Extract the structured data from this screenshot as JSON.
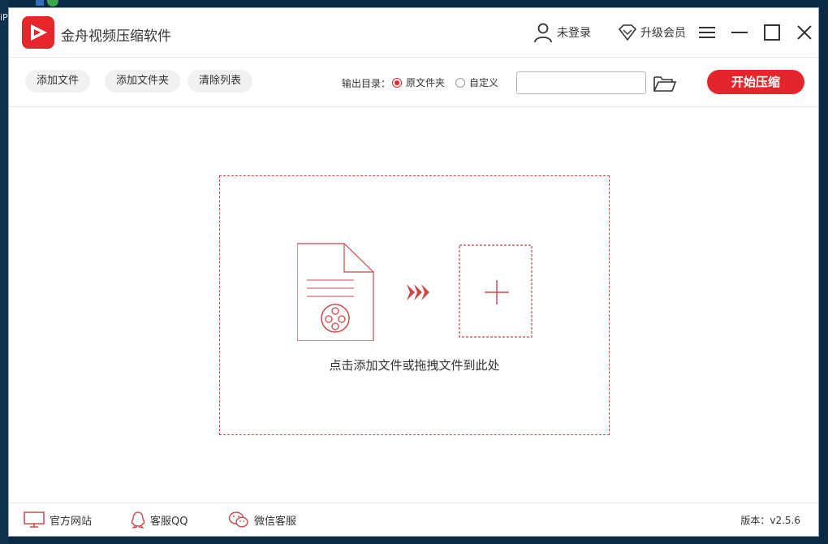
{
  "app": {
    "title": "金舟视频压缩软件"
  },
  "desktop": {
    "edge_text": "iPra"
  },
  "header": {
    "login_label": "未登录",
    "vip_label": "升级会员"
  },
  "toolbar": {
    "add_file": "添加文件",
    "add_folder": "添加文件夹",
    "clear_list": "清除列表",
    "output_label": "输出目录：",
    "radio_original": "原文件夹",
    "radio_custom": "自定义",
    "output_path_value": "",
    "start_button": "开始压缩"
  },
  "dropzone": {
    "hint": "点击添加文件或拖拽文件到此处"
  },
  "footer": {
    "official_site": "官方网站",
    "qq_support": "客服QQ",
    "wechat_support": "微信客服",
    "version": "版本：v2.5.6"
  },
  "colors": {
    "accent": "#e2262b",
    "dash_border": "#c8484c"
  },
  "icons": [
    "logo-icon",
    "user-icon",
    "diamond-icon",
    "menu-icon",
    "minimize-icon",
    "maximize-icon",
    "close-icon",
    "folder-open-icon",
    "document-icon",
    "film-reel-icon",
    "arrows-icon",
    "plus-icon",
    "monitor-icon",
    "qq-icon",
    "wechat-icon"
  ]
}
